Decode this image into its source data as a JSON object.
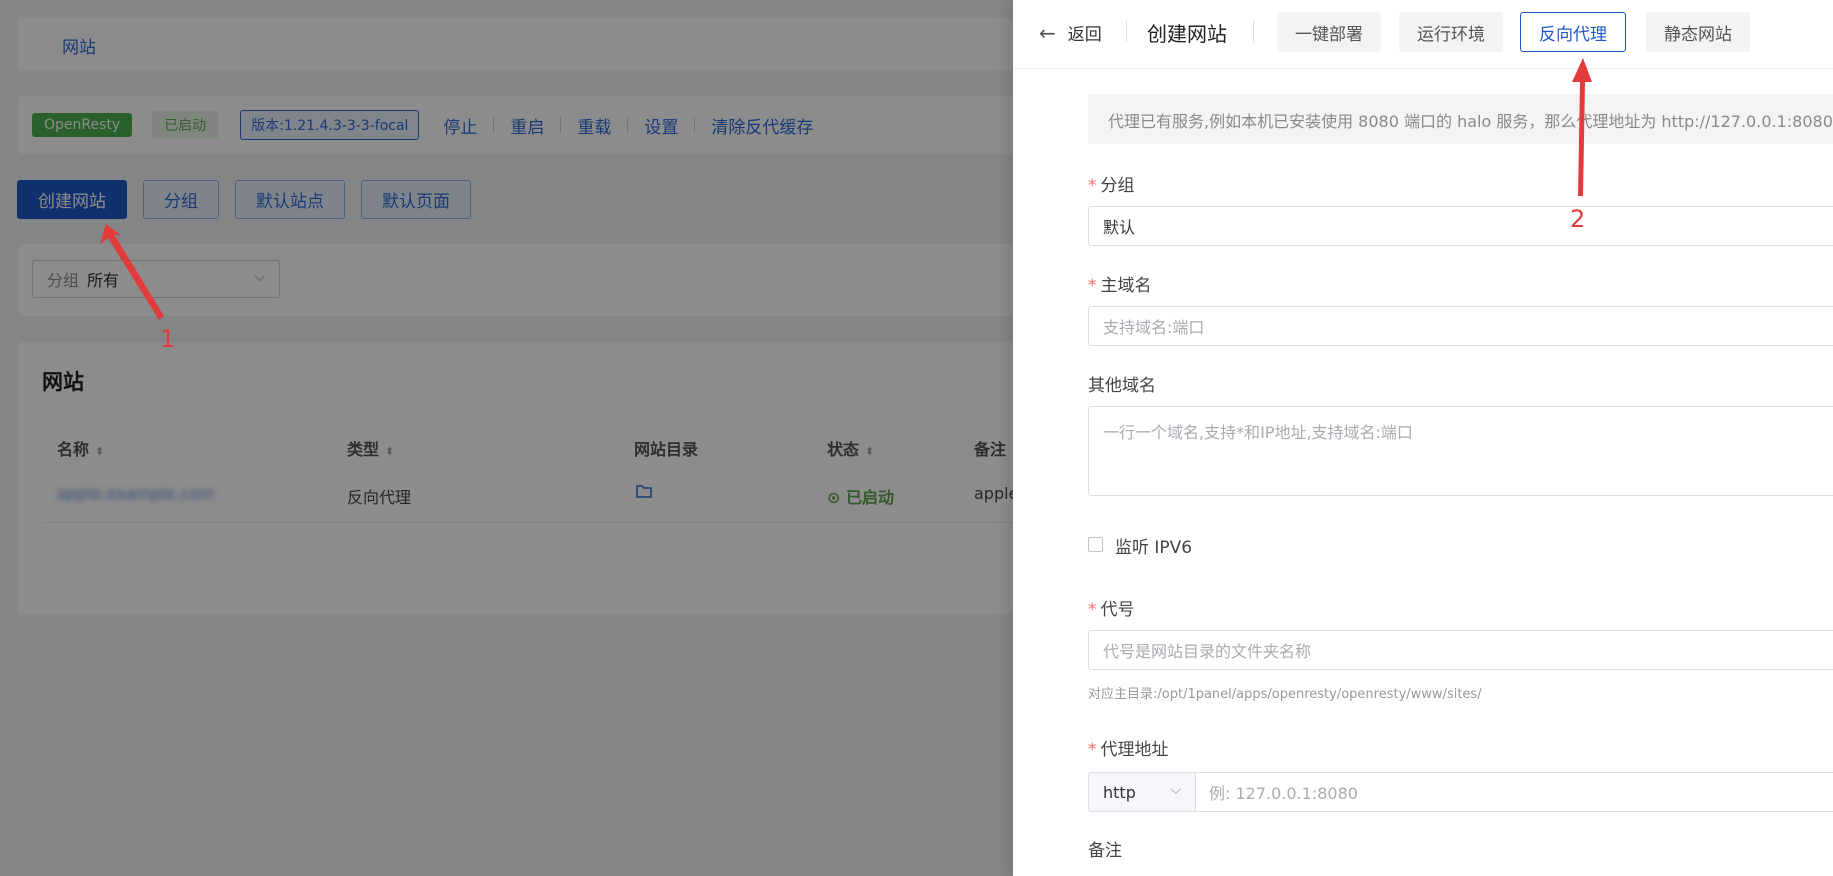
{
  "background": {
    "breadcrumb": "网站",
    "status": {
      "app_tag": "OpenResty",
      "state_tag": "已启动",
      "version_tag": "版本:1.21.4.3-3-3-focal",
      "actions": [
        "停止",
        "重启",
        "重载",
        "设置",
        "清除反代缓存"
      ]
    },
    "toolbar": [
      "创建网站",
      "分组",
      "默认站点",
      "默认页面"
    ],
    "filter": {
      "label": "分组",
      "value": "所有"
    },
    "table": {
      "title": "网站",
      "headers": [
        "名称",
        "类型",
        "网站目录",
        "状态",
        "备注"
      ],
      "row": {
        "name": "apple.example.com",
        "type": "反向代理",
        "status": "已启动",
        "remark": "apple"
      }
    }
  },
  "drawer": {
    "back_label": "返回",
    "title": "创建网站",
    "tabs": [
      "一键部署",
      "运行环境",
      "反向代理",
      "静态网站"
    ],
    "active_tab": "反向代理",
    "notice": "代理已有服务,例如本机已安装使用 8080 端口的 halo 服务，那么代理地址为 http://127.0.0.1:8080",
    "form": {
      "group_label": "分组",
      "group_value": "默认",
      "domain_label": "主域名",
      "domain_placeholder": "支持域名:端口",
      "other_label": "其他域名",
      "other_placeholder": "一行一个域名,支持*和IP地址,支持域名:端口",
      "ipv6_label": "监听 IPV6",
      "alias_label": "代号",
      "alias_placeholder": "代号是网站目录的文件夹名称",
      "alias_hint": "对应主目录:/opt/1panel/apps/openresty/openresty/www/sites/",
      "proxy_label": "代理地址",
      "proxy_protocol": "http",
      "proxy_placeholder": "例: 127.0.0.1:8080",
      "remark_label": "备注"
    }
  },
  "annotations": {
    "one": "1",
    "two": "2"
  },
  "colors": {
    "primary": "#1f58c9",
    "arrow": "#e23b3b",
    "success": "#5ea34f"
  }
}
